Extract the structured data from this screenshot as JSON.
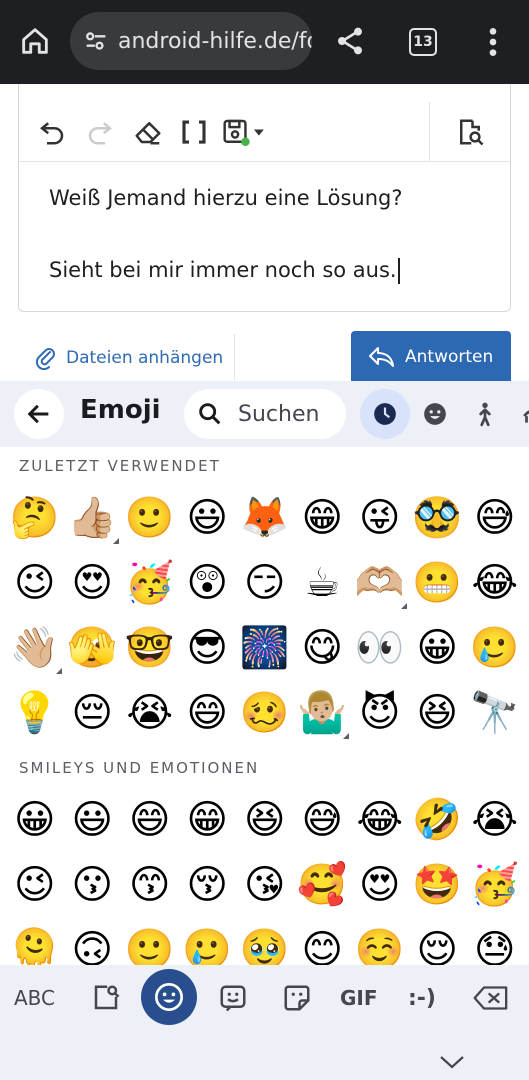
{
  "browser": {
    "url": "android-hilfe.de/fo",
    "tab_count": "13",
    "icons": [
      "home-icon",
      "site-settings-icon",
      "share-icon",
      "tab-switcher-icon",
      "more-vert-icon"
    ]
  },
  "editor": {
    "toolbar_icons": [
      "undo-icon",
      "redo-icon",
      "eraser-icon",
      "bbcode-icon",
      "save-draft-icon",
      "preview-icon"
    ],
    "line1": "Weiß Jemand hierzu eine Lösung?",
    "line2": "Sieht bei mir immer noch so aus."
  },
  "actions": {
    "attach_label": "Dateien anhängen",
    "reply_label": "Antworten",
    "reply_color": "#2d68b3"
  },
  "emoji_keyboard": {
    "title": "Emoji",
    "search_placeholder": "Suchen",
    "categories": [
      "recent-icon",
      "smileys-icon",
      "people-icon",
      "animals-icon"
    ],
    "section_recent": "ZULETZT VERWENDET",
    "section_smileys": "SMILEYS UND EMOTIONEN",
    "recent_rows": [
      [
        "🤔",
        "👍🏼",
        "🙂",
        "😃",
        "🦊",
        "😁",
        "😜",
        "🥸",
        "😅"
      ],
      [
        "😉",
        "😍",
        "🥳",
        "😲",
        "😏",
        "☕",
        "🫶🏼",
        "😬",
        "😂"
      ],
      [
        "👋🏼",
        "🫣",
        "🤓",
        "😎",
        "🎆",
        "😋",
        "👀",
        "😀",
        "🥲"
      ],
      [
        "💡",
        "😔",
        "😭",
        "😄",
        "🥴",
        "🤷🏼‍♂️",
        "😈",
        "😆",
        "🔭"
      ]
    ],
    "smiley_rows": [
      [
        "😀",
        "😃",
        "😄",
        "😁",
        "😆",
        "😅",
        "😂",
        "🤣",
        "😭"
      ],
      [
        "😉",
        "😗",
        "😙",
        "😚",
        "😘",
        "🥰",
        "😍",
        "🤩",
        "🥳"
      ],
      [
        "🫠",
        "🙃",
        "🙂",
        "🥲",
        "🥹",
        "😊",
        "☺️",
        "😌",
        "😓"
      ]
    ]
  },
  "keyboard_bar": {
    "abc_label": "ABC",
    "gif_label": "GIF",
    "emoticon_label": ":-)",
    "accent_color": "#284e8e"
  }
}
